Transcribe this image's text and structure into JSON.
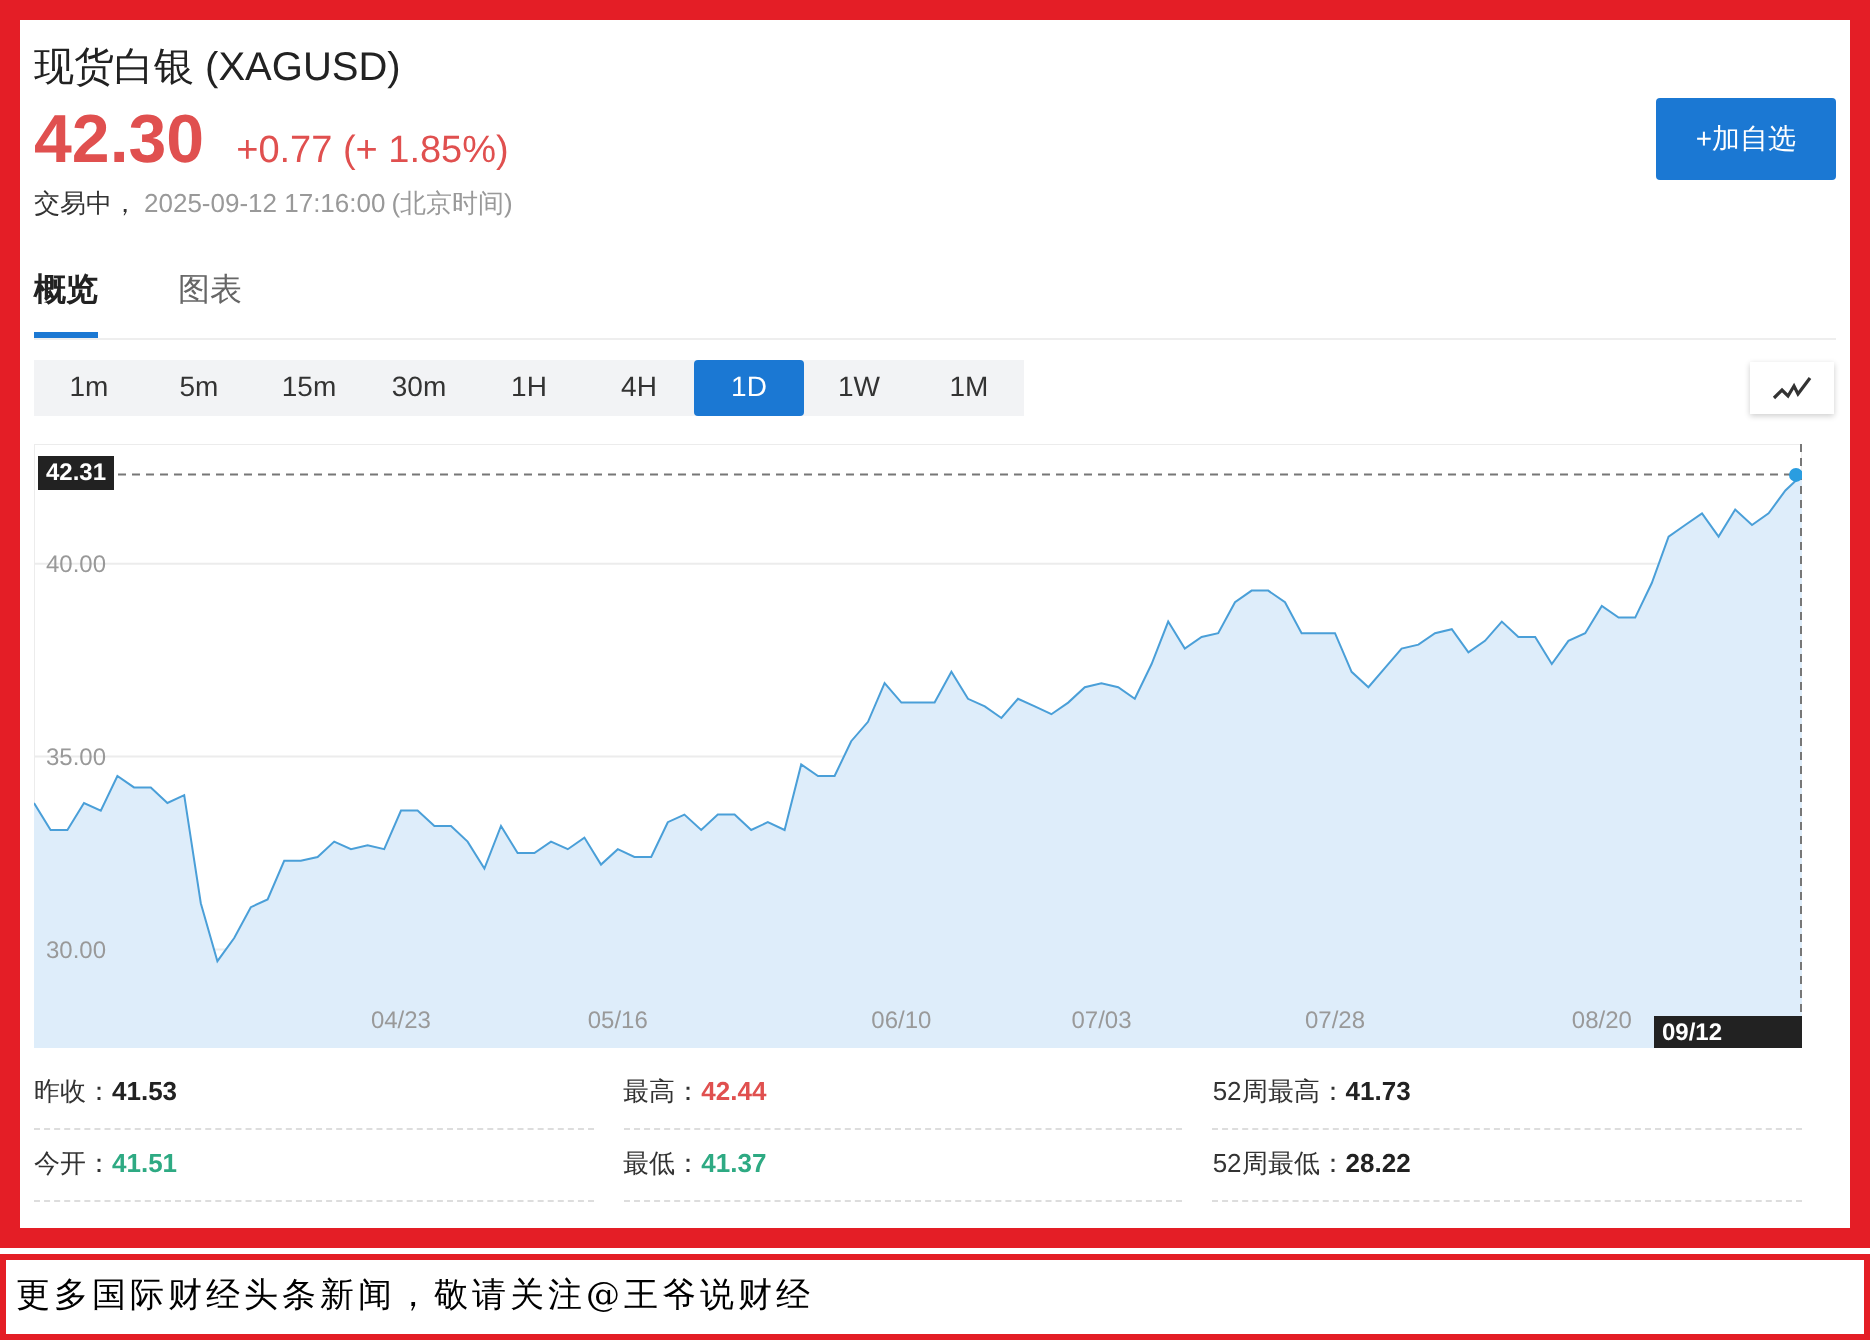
{
  "header": {
    "title": "现货白银 (XAGUSD)",
    "price": "42.30",
    "change": "+0.77 (+ 1.85%)",
    "color": "#e0504f",
    "status": "交易中，",
    "timestamp": "2025-09-12 17:16:00",
    "timezone": "(北京时间)",
    "watch_button": "+加自选"
  },
  "tabs": [
    {
      "label": "概览",
      "selected": true
    },
    {
      "label": "图表",
      "selected": false
    }
  ],
  "periods": [
    {
      "label": "1m",
      "selected": false
    },
    {
      "label": "5m",
      "selected": false
    },
    {
      "label": "15m",
      "selected": false
    },
    {
      "label": "30m",
      "selected": false
    },
    {
      "label": "1H",
      "selected": false
    },
    {
      "label": "4H",
      "selected": false
    },
    {
      "label": "1D",
      "selected": true
    },
    {
      "label": "1W",
      "selected": false
    },
    {
      "label": "1M",
      "selected": false
    }
  ],
  "chart": {
    "date_tag": "09/12",
    "chart_data": {
      "type": "area",
      "grid": true,
      "ref_lines": [
        {
          "axis": "y",
          "value": 42.31,
          "label": "42.31"
        }
      ],
      "categories": [
        null,
        null,
        null,
        null,
        null,
        null,
        null,
        null,
        null,
        null,
        null,
        null,
        null,
        null,
        null,
        null,
        null,
        null,
        null,
        null,
        null,
        null,
        "04/23",
        null,
        null,
        null,
        null,
        null,
        null,
        null,
        null,
        null,
        null,
        null,
        null,
        "05/16",
        null,
        null,
        null,
        null,
        null,
        null,
        null,
        null,
        null,
        null,
        null,
        null,
        null,
        null,
        null,
        null,
        "06/10",
        null,
        null,
        null,
        null,
        null,
        null,
        null,
        null,
        null,
        null,
        null,
        "07/03",
        null,
        null,
        null,
        null,
        null,
        null,
        null,
        null,
        null,
        null,
        null,
        null,
        null,
        "07/28",
        null,
        null,
        null,
        null,
        null,
        null,
        null,
        null,
        null,
        null,
        null,
        null,
        null,
        null,
        null,
        "08/20",
        null,
        null,
        null,
        null,
        null,
        null,
        null,
        null,
        null,
        null,
        null,
        null
      ],
      "series": [
        {
          "color": "#4a9fd8",
          "values": [
            33.8,
            33.1,
            33.1,
            33.8,
            33.6,
            34.5,
            34.2,
            34.2,
            33.8,
            34.0,
            31.2,
            29.7,
            30.3,
            31.1,
            31.3,
            32.3,
            32.3,
            32.4,
            32.8,
            32.6,
            32.7,
            32.6,
            33.6,
            33.6,
            33.2,
            33.2,
            32.8,
            32.1,
            33.2,
            32.5,
            32.5,
            32.8,
            32.6,
            32.9,
            32.2,
            32.6,
            32.4,
            32.4,
            33.3,
            33.5,
            33.1,
            33.5,
            33.5,
            33.1,
            33.3,
            33.1,
            34.8,
            34.5,
            34.5,
            35.4,
            35.9,
            36.9,
            36.4,
            36.4,
            36.4,
            37.2,
            36.5,
            36.3,
            36.0,
            36.5,
            36.3,
            36.1,
            36.4,
            36.8,
            36.9,
            36.8,
            36.5,
            37.4,
            38.5,
            37.8,
            38.1,
            38.2,
            39.0,
            39.3,
            39.3,
            39.0,
            38.2,
            38.2,
            38.2,
            37.2,
            36.8,
            37.3,
            37.8,
            37.9,
            38.2,
            38.3,
            37.7,
            38.0,
            38.5,
            38.1,
            38.1,
            37.4,
            38.0,
            38.2,
            38.9,
            38.6,
            38.6,
            39.5,
            40.7,
            41.0,
            41.3,
            40.7,
            41.4,
            41.0,
            41.3,
            41.9,
            42.3
          ]
        }
      ],
      "ylim": [
        27.45,
        43.1
      ],
      "yticks": [
        {
          "value": 30,
          "label": "30.00"
        },
        {
          "value": 35,
          "label": "35.00"
        },
        {
          "value": 40,
          "label": "40.00"
        }
      ]
    }
  },
  "stats": [
    {
      "label": "昨收：",
      "value": "41.53",
      "color": "#222222"
    },
    {
      "label": "最高：",
      "value": "42.44",
      "color": "#e0504f"
    },
    {
      "label": "52周最高：",
      "value": "41.73",
      "color": "#222222"
    },
    {
      "label": "今开：",
      "value": "41.51",
      "color": "#2eaa83"
    },
    {
      "label": "最低：",
      "value": "41.37",
      "color": "#2eaa83"
    },
    {
      "label": "52周最低：",
      "value": "28.22",
      "color": "#222222"
    }
  ],
  "caption": "更多国际财经头条新闻，敬请关注@王爷说财经"
}
